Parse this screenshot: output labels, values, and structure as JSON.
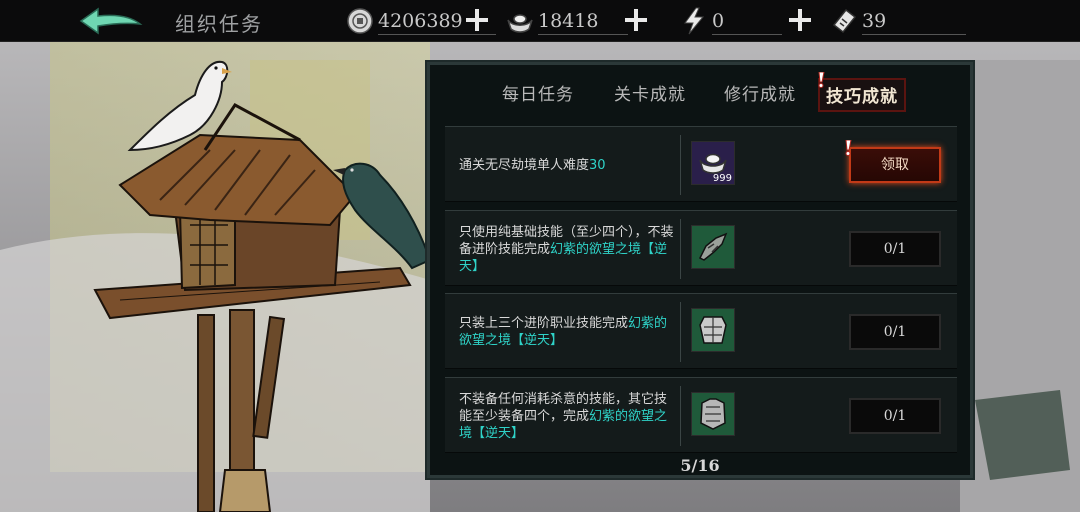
{
  "header": {
    "title": "组织任务",
    "resources": [
      {
        "icon": "coin-icon",
        "value": "4206389"
      },
      {
        "icon": "silver-ingot-icon",
        "value": "18418"
      },
      {
        "icon": "lightning-icon",
        "value": "0"
      },
      {
        "icon": "ticket-icon",
        "value": "39"
      }
    ]
  },
  "tabs": [
    {
      "label": "每日任务",
      "active": false
    },
    {
      "label": "关卡成就",
      "active": false
    },
    {
      "label": "修行成就",
      "active": false
    },
    {
      "label": "技巧成就",
      "active": true
    }
  ],
  "tasks": [
    {
      "desc_plain": "通关无尽劫境单人难度",
      "desc_hl": "30",
      "desc_tail": "",
      "reward_icon": "silver-ingot-icon",
      "reward_qty": "999",
      "button": "领取",
      "claimable": true
    },
    {
      "desc_plain": "只使用纯基础技能（至少四个），不装备进阶技能完成",
      "desc_hl": "幻紫的欲望之境",
      "desc_tail": "【逆天】",
      "reward_icon": "gauntlet-icon",
      "reward_qty": "",
      "button": "0/1",
      "claimable": false
    },
    {
      "desc_plain": "只装上三个进阶职业技能完成",
      "desc_hl": "幻紫的欲望之境",
      "desc_tail": "【逆天】",
      "reward_icon": "armor-icon",
      "reward_qty": "",
      "button": "0/1",
      "claimable": false
    },
    {
      "desc_plain": "不装备任何消耗杀意的技能，其它技能至少装备四个，完成",
      "desc_hl": "幻紫的欲望之境",
      "desc_tail": "【逆天】",
      "reward_icon": "chest-armor-icon",
      "reward_qty": "",
      "button": "0/1",
      "claimable": false
    }
  ],
  "pagination": {
    "label": "5/16"
  },
  "colors": {
    "accent_teal": "#2fd3c8",
    "claim_border": "#c23a17",
    "active_tab_border": "#5b1410"
  }
}
